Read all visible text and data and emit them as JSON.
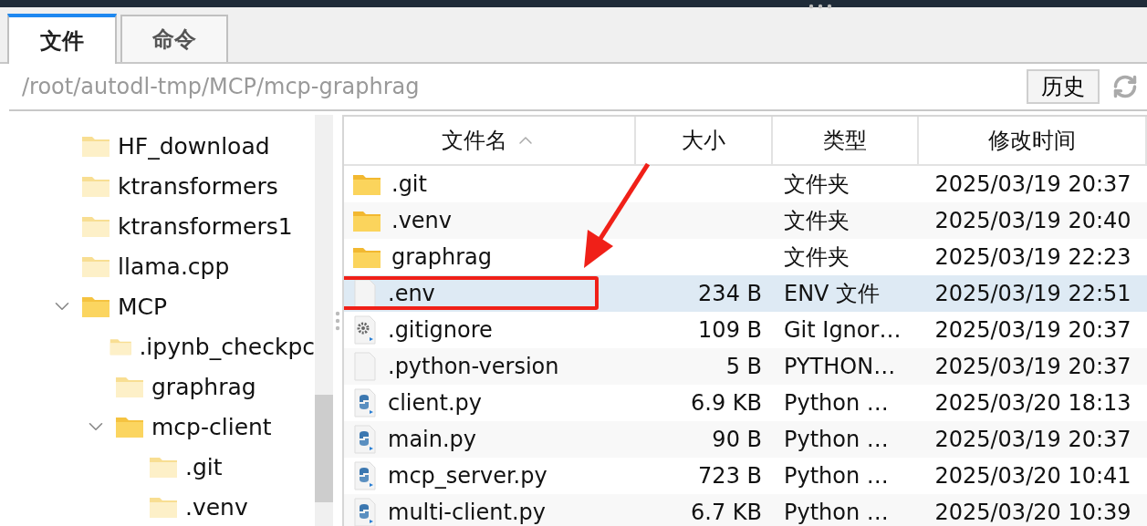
{
  "tabs": [
    {
      "label": "文件",
      "selected": true
    },
    {
      "label": "命令",
      "selected": false
    }
  ],
  "path": {
    "value": "/root/autodl-tmp/MCP/mcp-graphrag"
  },
  "history_button": "历史",
  "tree": [
    {
      "name": "HF_download"
    },
    {
      "name": "ktransformers"
    },
    {
      "name": "ktransformers1"
    },
    {
      "name": "llama.cpp"
    },
    {
      "name": "MCP",
      "expanded": true,
      "children": [
        {
          "name": ".ipynb_checkpc"
        },
        {
          "name": "graphrag"
        },
        {
          "name": "mcp-client",
          "expanded": true,
          "children": [
            {
              "name": ".git"
            },
            {
              "name": ".venv"
            }
          ]
        }
      ]
    }
  ],
  "table": {
    "columns": [
      {
        "label": "文件名",
        "sorted": true
      },
      {
        "label": "大小",
        "sorted": false
      },
      {
        "label": "类型",
        "sorted": false
      },
      {
        "label": "修改时间",
        "sorted": false
      }
    ],
    "rows": [
      {
        "kind": "folder",
        "name": ".git",
        "size": "",
        "type": "文件夹",
        "modified": "2025/03/19 20:37",
        "selected": false,
        "annotated": false
      },
      {
        "kind": "folder",
        "name": ".venv",
        "size": "",
        "type": "文件夹",
        "modified": "2025/03/19 20:40",
        "selected": false,
        "annotated": false
      },
      {
        "kind": "folder",
        "name": "graphrag",
        "size": "",
        "type": "文件夹",
        "modified": "2025/03/19 22:23",
        "selected": false,
        "annotated": false
      },
      {
        "kind": "file",
        "name": ".env",
        "size": "234 B",
        "type": "ENV 文件",
        "modified": "2025/03/19 22:51",
        "selected": true,
        "annotated": true
      },
      {
        "kind": "config",
        "name": ".gitignore",
        "size": "109 B",
        "type": "Git Ignor…",
        "modified": "2025/03/19 20:37",
        "selected": false,
        "annotated": false
      },
      {
        "kind": "file",
        "name": ".python-version",
        "size": "5 B",
        "type": "PYTHON…",
        "modified": "2025/03/19 20:37",
        "selected": false,
        "annotated": false
      },
      {
        "kind": "python",
        "name": "client.py",
        "size": "6.9 KB",
        "type": "Python …",
        "modified": "2025/03/20 18:13",
        "selected": false,
        "annotated": false
      },
      {
        "kind": "python",
        "name": "main.py",
        "size": "90 B",
        "type": "Python …",
        "modified": "2025/03/19 20:37",
        "selected": false,
        "annotated": false
      },
      {
        "kind": "python",
        "name": "mcp_server.py",
        "size": "723 B",
        "type": "Python …",
        "modified": "2025/03/20 10:41",
        "selected": false,
        "annotated": false
      },
      {
        "kind": "python",
        "name": "multi-client.py",
        "size": "6.7 KB",
        "type": "Python …",
        "modified": "2025/03/20 10:39",
        "selected": false,
        "annotated": false
      }
    ]
  }
}
